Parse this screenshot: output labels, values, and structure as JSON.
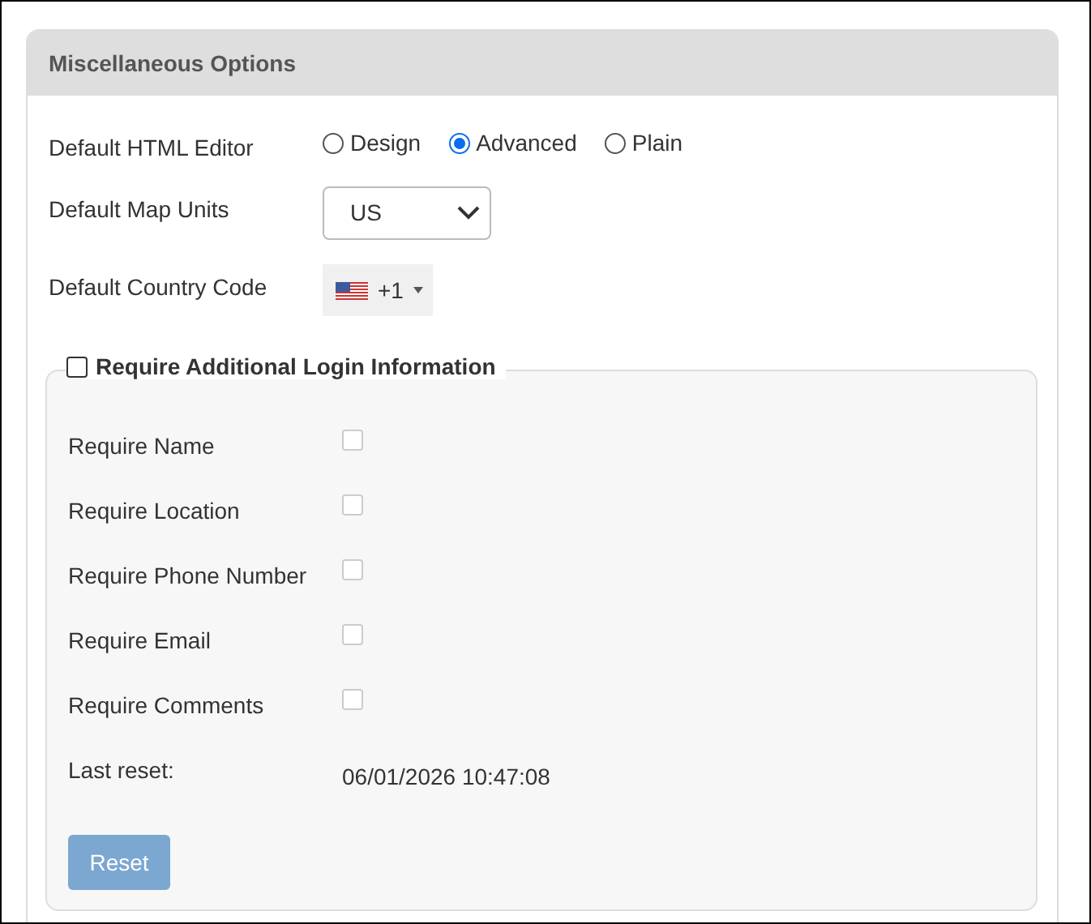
{
  "panel": {
    "title": "Miscellaneous Options"
  },
  "html_editor": {
    "label": "Default HTML Editor",
    "options": [
      {
        "label": "Design",
        "selected": false
      },
      {
        "label": "Advanced",
        "selected": true
      },
      {
        "label": "Plain",
        "selected": false
      }
    ]
  },
  "map_units": {
    "label": "Default Map Units",
    "value": "US"
  },
  "country_code": {
    "label": "Default Country Code",
    "value": "+1"
  },
  "login_info": {
    "label": "Require Additional Login Information",
    "checked": false,
    "requirements": [
      {
        "label": "Require Name",
        "checked": false,
        "disabled": true
      },
      {
        "label": "Require Location",
        "checked": false,
        "disabled": true
      },
      {
        "label": "Require Phone Number",
        "checked": false,
        "disabled": true
      },
      {
        "label": "Require Email",
        "checked": false,
        "disabled": true
      },
      {
        "label": "Require Comments",
        "checked": false,
        "disabled": true
      }
    ],
    "last_reset": {
      "label": "Last reset:",
      "value": "06/01/2026 10:47:08"
    },
    "reset_button": {
      "label": "Reset",
      "disabled": true
    }
  }
}
